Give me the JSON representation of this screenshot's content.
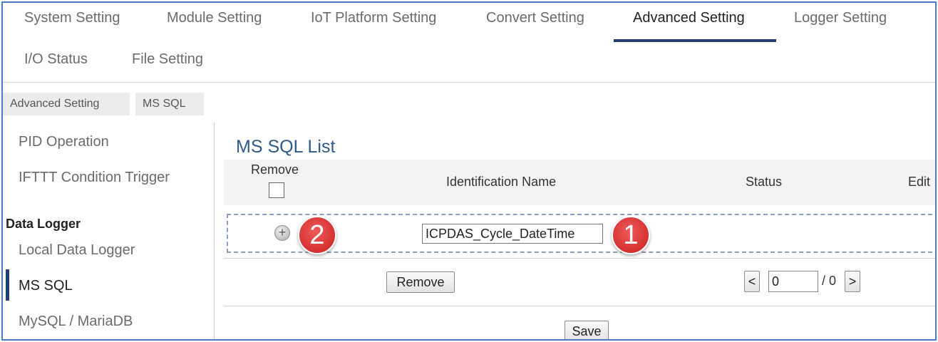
{
  "top_tabs": [
    {
      "label": "System Setting"
    },
    {
      "label": "Module Setting"
    },
    {
      "label": "IoT Platform Setting"
    },
    {
      "label": "Convert Setting"
    },
    {
      "label": "Advanced Setting",
      "active": true
    },
    {
      "label": "Logger Setting"
    },
    {
      "label": "I/O Status"
    },
    {
      "label": "File Setting"
    }
  ],
  "breadcrumb": [
    "Advanced Setting",
    "MS SQL"
  ],
  "sidebar": {
    "items_top": [
      "PID Operation",
      "IFTTT Condition Trigger"
    ],
    "group_label": "Data Logger",
    "items": [
      "Local Data Logger",
      "MS SQL",
      "MySQL / MariaDB"
    ],
    "active_item": "MS SQL"
  },
  "main": {
    "title": "MS SQL List",
    "columns": {
      "remove": "Remove",
      "identification_name": "Identification Name",
      "status": "Status",
      "edit": "Edit"
    },
    "new_row": {
      "add_icon": "plus-circle-icon",
      "name_value": "ICPDAS_Cycle_DateTime"
    },
    "remove_button": "Remove",
    "pagination": {
      "prev_label": "<",
      "next_label": ">",
      "page_value": "0",
      "total": "/ 0"
    },
    "save_button": "Save"
  },
  "badges": [
    "1",
    "2"
  ],
  "colors": {
    "accent": "#1f3f73",
    "title": "#2f5b8a",
    "badge": "#d93535",
    "frame": "#4a7bc4"
  }
}
